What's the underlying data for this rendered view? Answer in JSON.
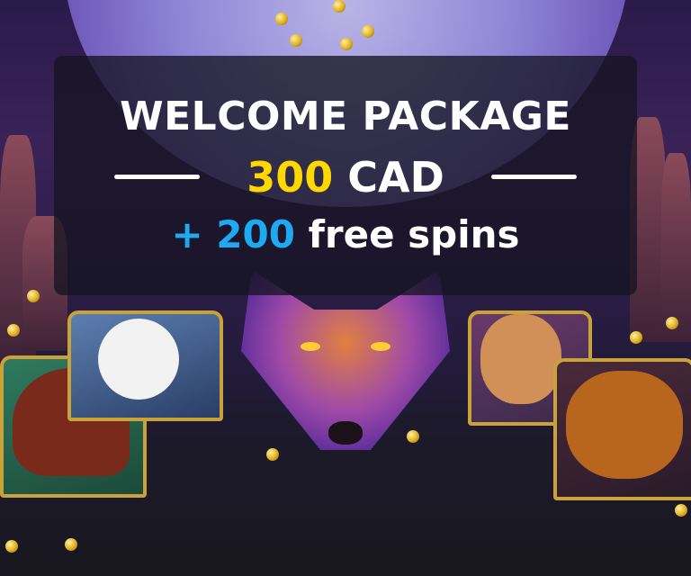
{
  "promo": {
    "title": "WELCOME PACKAGE",
    "amount": "300",
    "currency": "CAD",
    "plus": "+",
    "spins_count": "200",
    "spins_label": "free spins"
  },
  "colors": {
    "amount": "#ffd800",
    "spins": "#1eaaf1",
    "text": "#ffffff"
  }
}
